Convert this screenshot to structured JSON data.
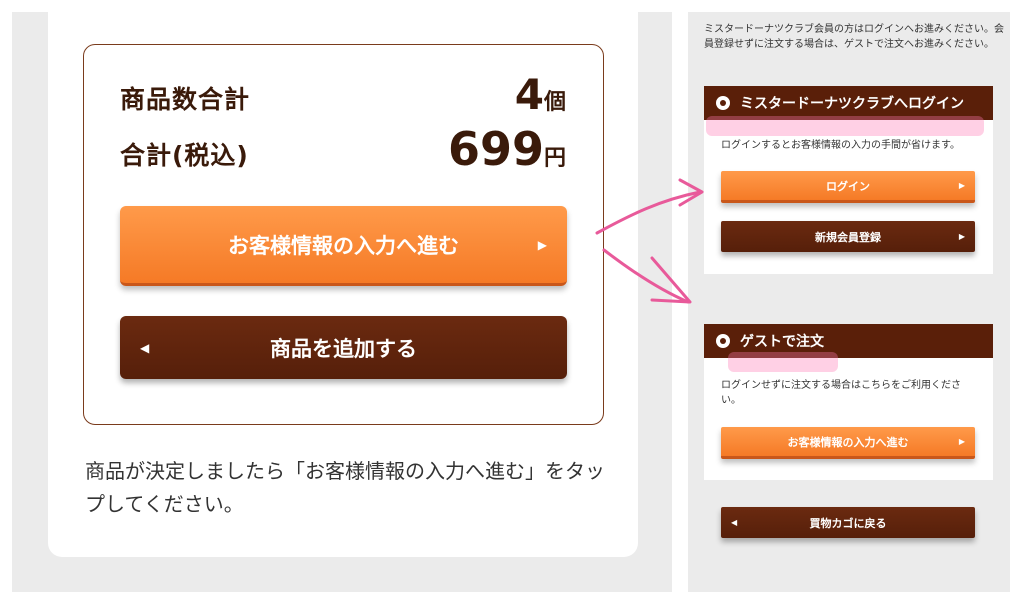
{
  "summary": {
    "qty_label": "商品数合計",
    "qty_value": "4",
    "qty_unit": "個",
    "total_label": "合計(税込)",
    "total_value": "699",
    "total_unit": "円"
  },
  "left_buttons": {
    "proceed": "お客様情報の入力へ進む",
    "add_items": "商品を追加する"
  },
  "left_note": "商品が決定しましたら「お客様情報の入力へ進む」をタップしてください。",
  "right": {
    "intro": "ミスタードーナツクラブ会員の方はログインへお進みください。会員登録せずに注文する場合は、ゲストで注文へお進みください。",
    "login_section": {
      "title": "ミスタードーナツクラブへログイン",
      "desc": "ログインするとお客様情報の入力の手間が省けます。",
      "login_button": "ログイン",
      "register_button": "新規会員登録"
    },
    "guest_section": {
      "title": "ゲストで注文",
      "desc": "ログインせずに注文する場合はこちらをご利用ください。",
      "proceed_button": "お客様情報の入力へ進む"
    },
    "back_button": "買物カゴに戻る"
  },
  "colors": {
    "orange": "#f57a26",
    "brown": "#5a1f09",
    "annotation_pink": "#e85a9a"
  }
}
